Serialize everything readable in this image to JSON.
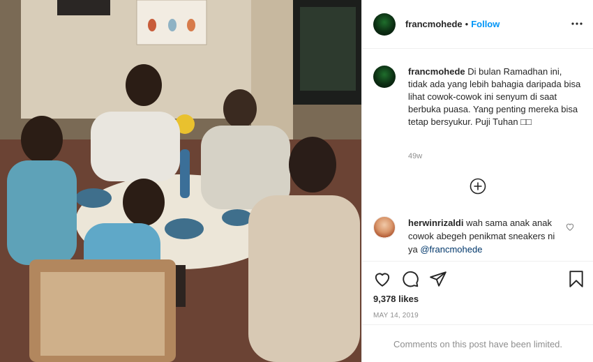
{
  "post": {
    "username": "francmohede",
    "separator": "•",
    "follow_label": "Follow"
  },
  "caption": {
    "username": "francmohede",
    "text": "Di bulan Ramadhan ini, tidak ada yang lebih bahagia daripada bisa lihat cowok-cowok ini senyum di saat berbuka puasa. Yang penting mereka bisa tetap bersyukur. Puji Tuhan □□",
    "time": "49w"
  },
  "comment": {
    "username": "herwinrizaldi",
    "text": "wah sama anak anak cowok abegeh penikmat sneakers ni ya",
    "mention": "@francmohede"
  },
  "stats": {
    "likes": "9,378 likes",
    "date": "MAY 14, 2019"
  },
  "comments_limited": "Comments on this post have been limited.",
  "icons": [
    "more-options-icon",
    "load-more-comments-icon",
    "like-comment-icon",
    "like-icon",
    "comment-icon",
    "share-icon",
    "save-icon"
  ],
  "colors": {
    "accent": "#0095f6",
    "muted": "#8e8e8e",
    "text": "#262626",
    "border": "#efefef"
  }
}
